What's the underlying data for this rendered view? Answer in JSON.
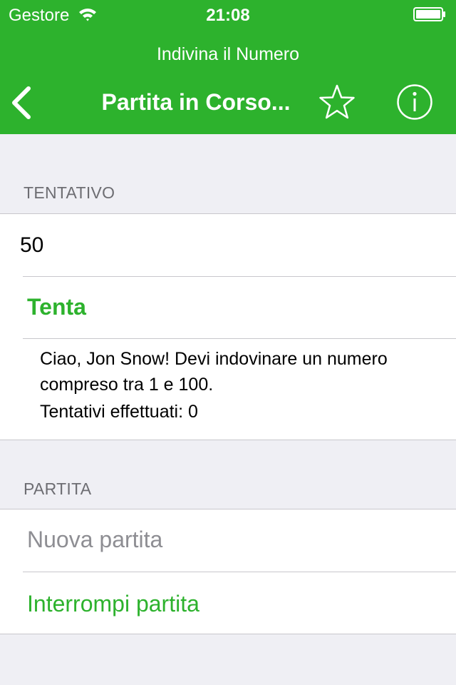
{
  "status_bar": {
    "carrier": "Gestore",
    "time": "21:08",
    "wifi_icon": "wifi-icon",
    "battery_icon": "battery-icon"
  },
  "nav": {
    "app_title": "Indivina il Numero",
    "title": "Partita in Corso...",
    "back_icon": "chevron-left-icon",
    "favorite_icon": "star-icon",
    "info_icon": "info-icon"
  },
  "sections": {
    "guess": {
      "header": "TENTATIVO",
      "input_value": "50",
      "submit_label": "Tenta",
      "message": "Ciao, Jon Snow! Devi indovinare un numero compreso tra 1 e 100.",
      "attempts_text": "Tentativi effettuati: 0"
    },
    "game": {
      "header": "PARTITA",
      "new_game_label": "Nuova partita",
      "stop_game_label": "Interrompi partita"
    }
  },
  "colors": {
    "accent": "#2db22d",
    "background": "#efeff4",
    "disabled_text": "#8e8e93",
    "separator": "#c8c7cc"
  }
}
